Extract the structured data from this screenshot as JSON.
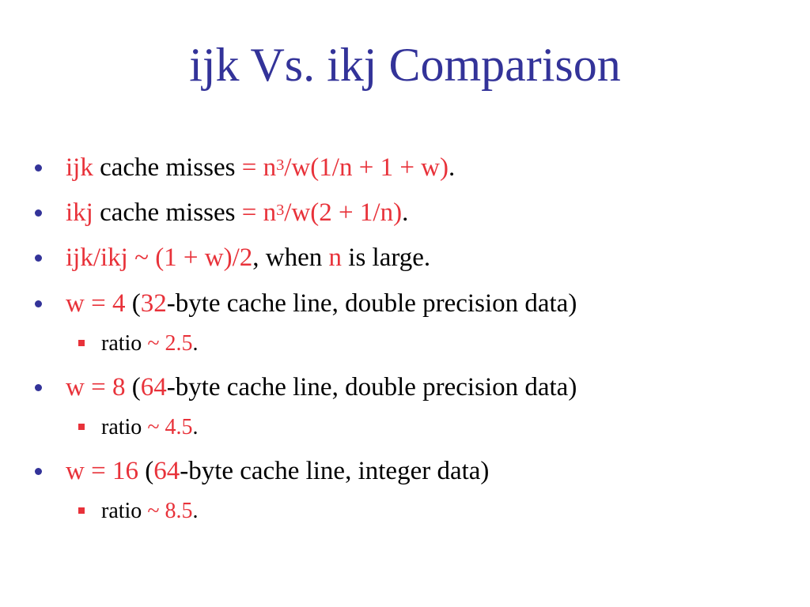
{
  "slide": {
    "title": "ijk Vs. ikj Comparison",
    "bullets": [
      {
        "level": 1,
        "segments": [
          {
            "text": "ijk",
            "color": "red"
          },
          {
            "text": " cache misses ",
            "color": "black"
          },
          {
            "text": "= n",
            "color": "red"
          },
          {
            "text": "3",
            "color": "red",
            "sup": true
          },
          {
            "text": "/w(1/n + 1 + w)",
            "color": "red"
          },
          {
            "text": ".",
            "color": "black"
          }
        ]
      },
      {
        "level": 1,
        "segments": [
          {
            "text": "ikj",
            "color": "red"
          },
          {
            "text": " cache misses ",
            "color": "black"
          },
          {
            "text": "= n",
            "color": "red"
          },
          {
            "text": "3",
            "color": "red",
            "sup": true
          },
          {
            "text": "/w(2 + 1/n)",
            "color": "red"
          },
          {
            "text": ".",
            "color": "black"
          }
        ]
      },
      {
        "level": 1,
        "segments": [
          {
            "text": "ijk/ikj ~ (1 + w)/2",
            "color": "red"
          },
          {
            "text": ", when ",
            "color": "black"
          },
          {
            "text": "n",
            "color": "red"
          },
          {
            "text": " is large.",
            "color": "black"
          }
        ]
      },
      {
        "level": 1,
        "segments": [
          {
            "text": "w = 4",
            "color": "red"
          },
          {
            "text": " (",
            "color": "black"
          },
          {
            "text": "32",
            "color": "red"
          },
          {
            "text": "-byte cache line, double precision data)",
            "color": "black"
          }
        ]
      },
      {
        "level": 2,
        "segments": [
          {
            "text": "ratio ",
            "color": "black"
          },
          {
            "text": "~ 2.5",
            "color": "red"
          },
          {
            "text": ".",
            "color": "black"
          }
        ]
      },
      {
        "level": 1,
        "segments": [
          {
            "text": "w = 8",
            "color": "red"
          },
          {
            "text": " (",
            "color": "black"
          },
          {
            "text": "64",
            "color": "red"
          },
          {
            "text": "-byte cache line, double precision data)",
            "color": "black"
          }
        ]
      },
      {
        "level": 2,
        "segments": [
          {
            "text": "ratio ",
            "color": "black"
          },
          {
            "text": "~ 4.5",
            "color": "red"
          },
          {
            "text": ".",
            "color": "black"
          }
        ]
      },
      {
        "level": 1,
        "segments": [
          {
            "text": "w = 16",
            "color": "red"
          },
          {
            "text": " (",
            "color": "black"
          },
          {
            "text": "64",
            "color": "red"
          },
          {
            "text": "-byte cache line, integer data)",
            "color": "black"
          }
        ]
      },
      {
        "level": 2,
        "segments": [
          {
            "text": "ratio ",
            "color": "black"
          },
          {
            "text": "~ 8.5",
            "color": "red"
          },
          {
            "text": ".",
            "color": "black"
          }
        ]
      }
    ]
  },
  "colors": {
    "title": "#333399",
    "accent": "#e8323a",
    "text": "#000000",
    "bullet_level1": "#333399",
    "bullet_level2": "#e8323a"
  }
}
